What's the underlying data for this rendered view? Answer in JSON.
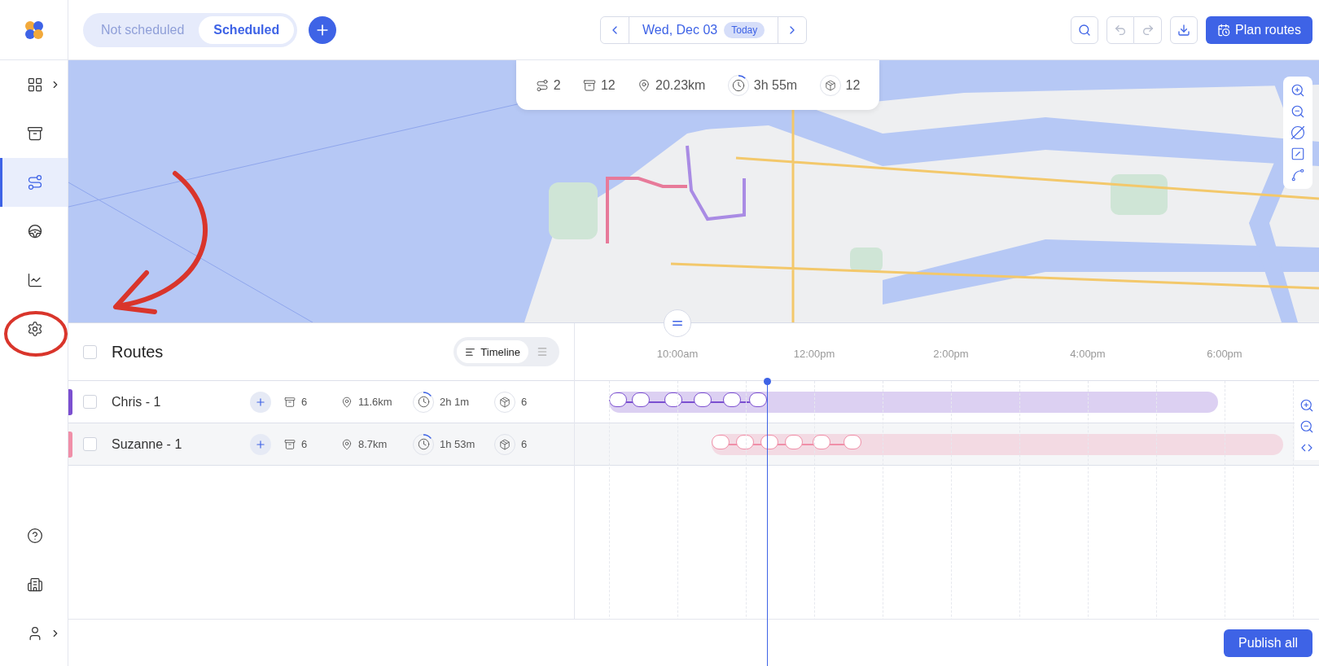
{
  "sidebar": {
    "items": [
      {
        "selected": false,
        "has_submenu": true
      },
      {
        "selected": false,
        "has_submenu": false
      },
      {
        "selected": true,
        "has_submenu": false
      },
      {
        "selected": false,
        "has_submenu": false
      },
      {
        "selected": false,
        "has_submenu": false
      },
      {
        "selected": false,
        "has_submenu": false
      }
    ],
    "bottom_items": [
      {
        "has_submenu": false
      },
      {
        "has_submenu": false
      },
      {
        "has_submenu": true
      }
    ]
  },
  "tabs": [
    {
      "label": "Not scheduled",
      "selected": false
    },
    {
      "label": "Scheduled",
      "selected": true
    }
  ],
  "date_nav": {
    "date": "Wed, Dec 03",
    "badge": "Today"
  },
  "toolbar": {
    "undo_disabled": true,
    "redo_disabled": true,
    "primary_button": "Plan routes"
  },
  "map_summary": {
    "routes": "2",
    "stops": "12",
    "distance": "20.23km",
    "duration": "3h 55m",
    "capacity": "12"
  },
  "routes_panel": {
    "title": "Routes",
    "all_checked": false,
    "view_toggle": [
      {
        "kind": "timeline",
        "label": "Timeline",
        "selected": true
      },
      {
        "kind": "list",
        "selected": false
      }
    ]
  },
  "routes": [
    {
      "name": "Chris - 1",
      "color": "#7b4fd0",
      "checked": false,
      "stops": "6",
      "distance": "11.6km",
      "duration": "2h 1m",
      "capacity": "6"
    },
    {
      "name": "Suzanne - 1",
      "color": "#f08fa8",
      "checked": false,
      "stops": "6",
      "distance": "8.7km",
      "duration": "1h 53m",
      "capacity": "6"
    }
  ],
  "timeline": {
    "ticks": [
      "10:00am",
      "12:00pm",
      "2:00pm",
      "4:00pm",
      "6:00pm"
    ]
  },
  "footer": {
    "button": "Publish all"
  }
}
